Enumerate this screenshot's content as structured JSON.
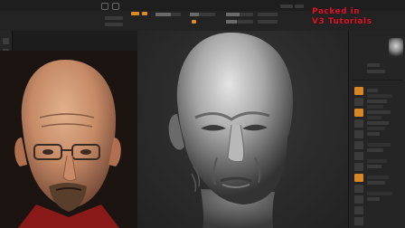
{
  "watermark": {
    "line1": "Packed in",
    "line2": "V3 Tutorials"
  },
  "toolbar": {
    "icons": [
      "brush-icon",
      "stroke-icon",
      "alpha-icon",
      "texture-icon",
      "material-icon",
      "color-swatch-icon"
    ]
  },
  "colors": {
    "accent": "#e08a20",
    "watermark": "#d8162a",
    "background": "#1c1c1c"
  }
}
